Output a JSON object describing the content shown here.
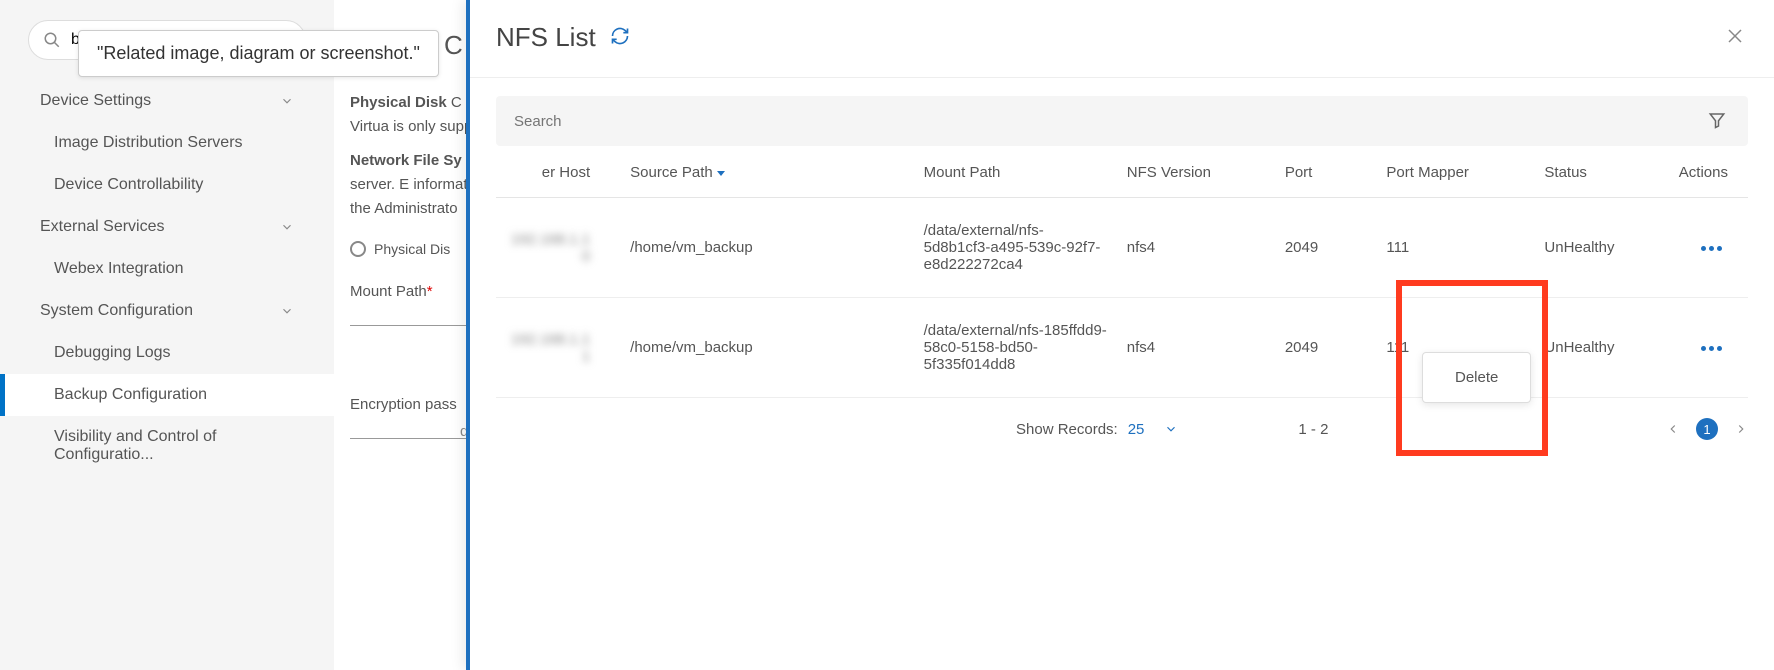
{
  "sidebar": {
    "search_value": "b",
    "tooltip": "\"Related image, diagram or screenshot.\"",
    "groups": [
      {
        "label": "Device Settings",
        "items": [
          "Image Distribution Servers",
          "Device Controllability"
        ]
      },
      {
        "label": "External Services",
        "items": [
          "Webex Integration"
        ]
      },
      {
        "label": "System Configuration",
        "items": [
          "Debugging Logs",
          "Backup Configuration",
          "Visibility and Control of Configuratio..."
        ]
      }
    ]
  },
  "main": {
    "title": "Backup C",
    "p1_bold": "Physical Disk",
    "p1": "C disk to the Virtua is only supporte",
    "p2_bold": "Network File Sy",
    "p2": "remote server. E information abou the Administrato",
    "radio": "Physical Dis",
    "mount_label": "Mount Path",
    "enc_label": "Encryption pass",
    "suffix": "d(s)"
  },
  "modal": {
    "title": "NFS List",
    "search_placeholder": "Search",
    "columns": {
      "host": "er Host",
      "src": "Source Path",
      "mount": "Mount Path",
      "ver": "NFS Version",
      "port": "Port",
      "pm": "Port Mapper",
      "status": "Status",
      "actions": "Actions"
    },
    "rows": [
      {
        "host": "",
        "src": "/home/vm_backup",
        "mount": "/data/external/nfs-5d8b1cf3-a495-539c-92f7-e8d222272ca4",
        "ver": "nfs4",
        "port": "2049",
        "pm": "111",
        "status": "UnHealthy"
      },
      {
        "host": "",
        "src": "/home/vm_backup",
        "mount": "/data/external/nfs-185ffdd9-58c0-5158-bd50-5f335f014dd8",
        "ver": "nfs4",
        "port": "2049",
        "pm": "111",
        "status": "UnHealthy"
      }
    ],
    "action_menu": "Delete",
    "pager": {
      "show_label": "Show Records:",
      "show_value": "25",
      "range": "1 - 2",
      "page": "1"
    }
  }
}
